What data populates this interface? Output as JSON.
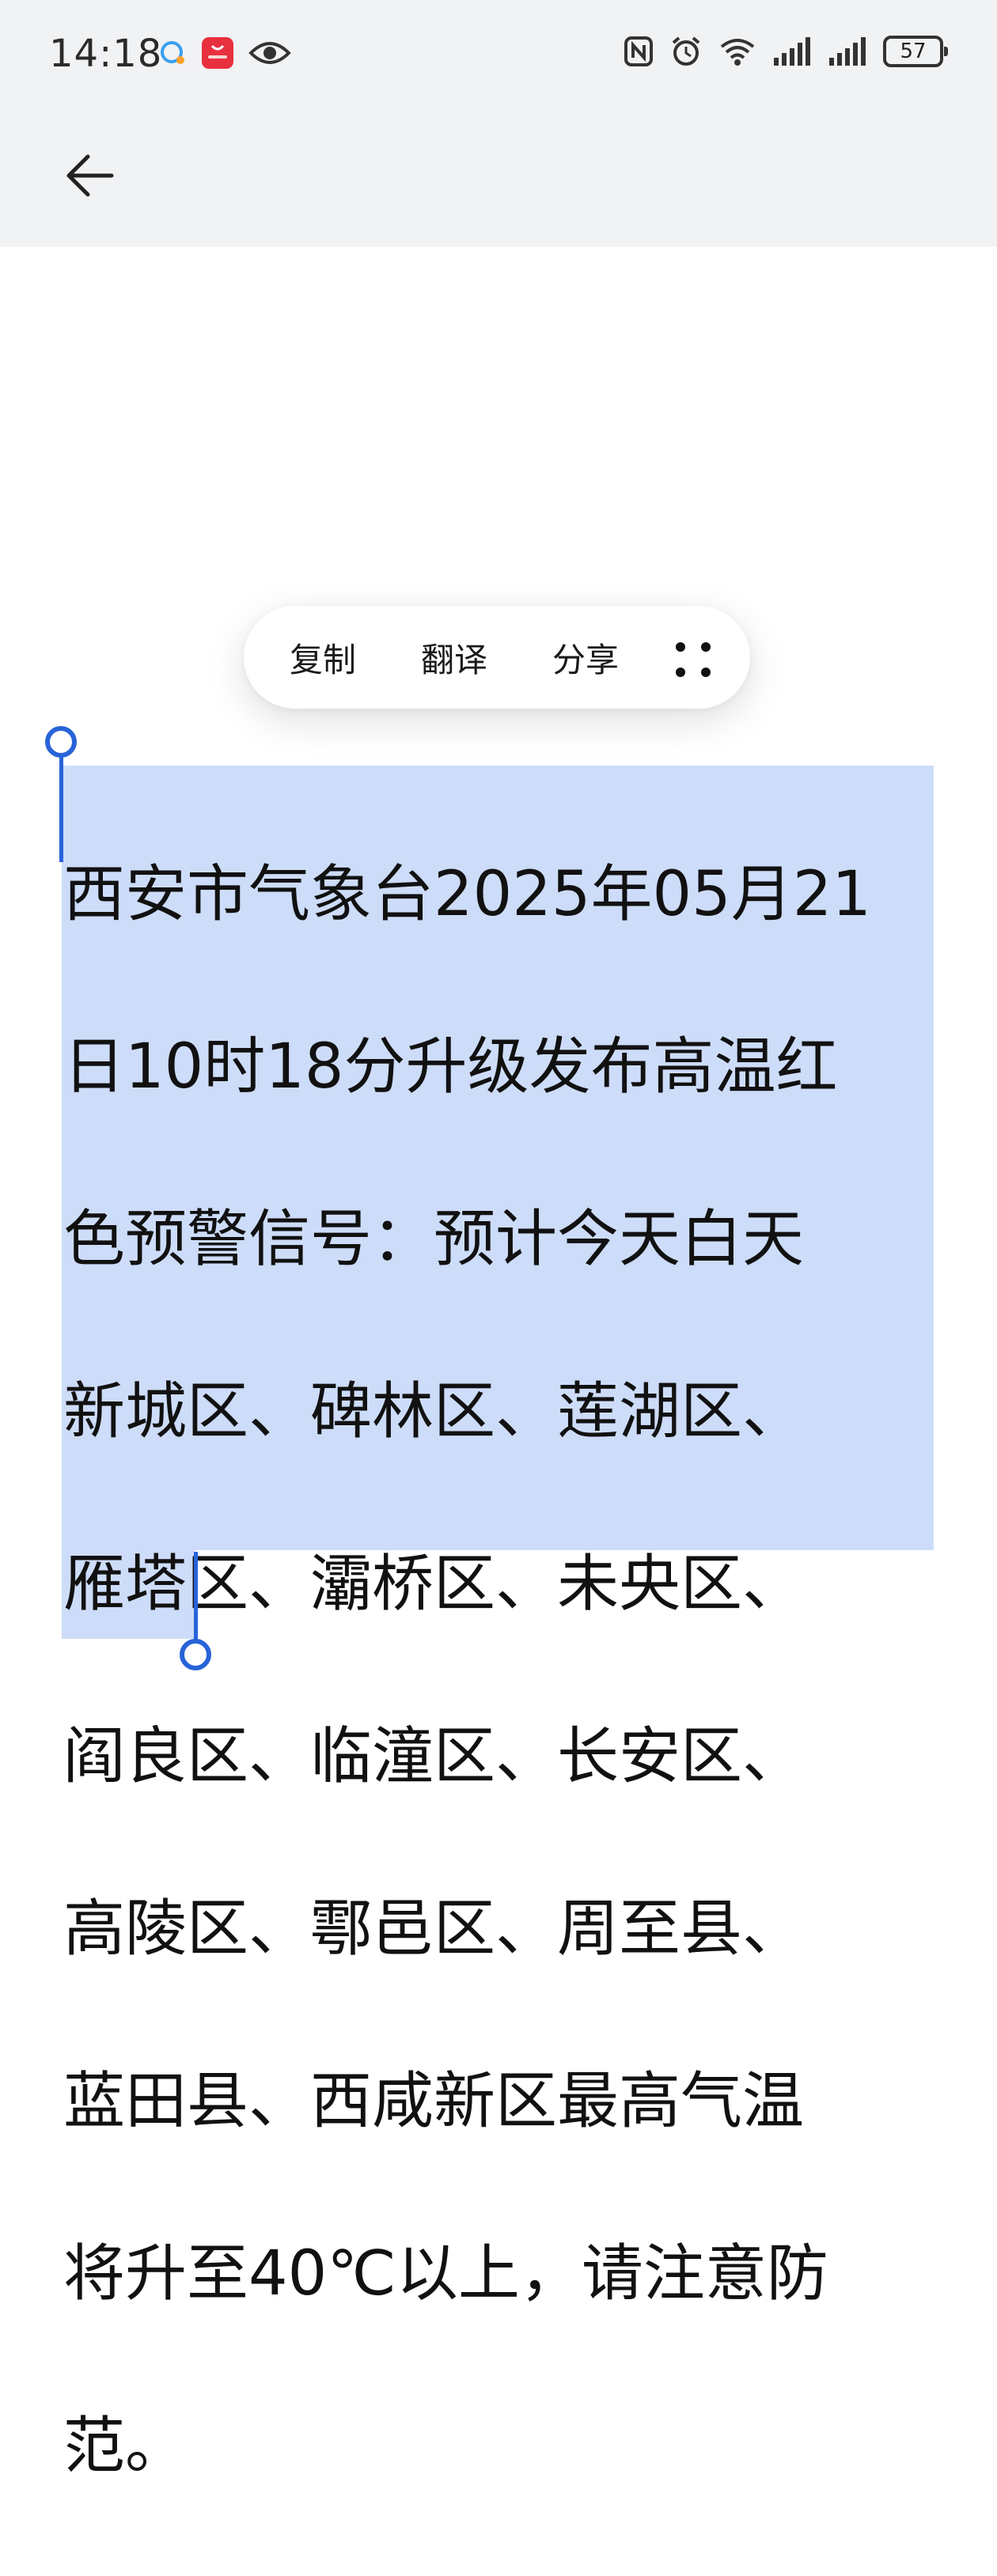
{
  "status_bar": {
    "time": "14:18",
    "battery": "57"
  },
  "context_menu": {
    "copy": "复制",
    "translate": "翻译",
    "share": "分享"
  },
  "text_lines": [
    "西安市气象台2025年05月21",
    "日10时18分升级发布高温红",
    "色预警信号：预计今天白天",
    "新城区、碑林区、莲湖区、",
    "雁塔区、灞桥区、未央区、",
    "阎良区、临潼区、长安区、",
    "高陵区、鄠邑区、周至县、",
    "蓝田县、西咸新区最高气温",
    "将升至40℃以上，请注意防",
    "范。"
  ],
  "colors": {
    "selection": "#cddcf9",
    "handle": "#2764d8",
    "top_background": "#f1f2f4"
  }
}
